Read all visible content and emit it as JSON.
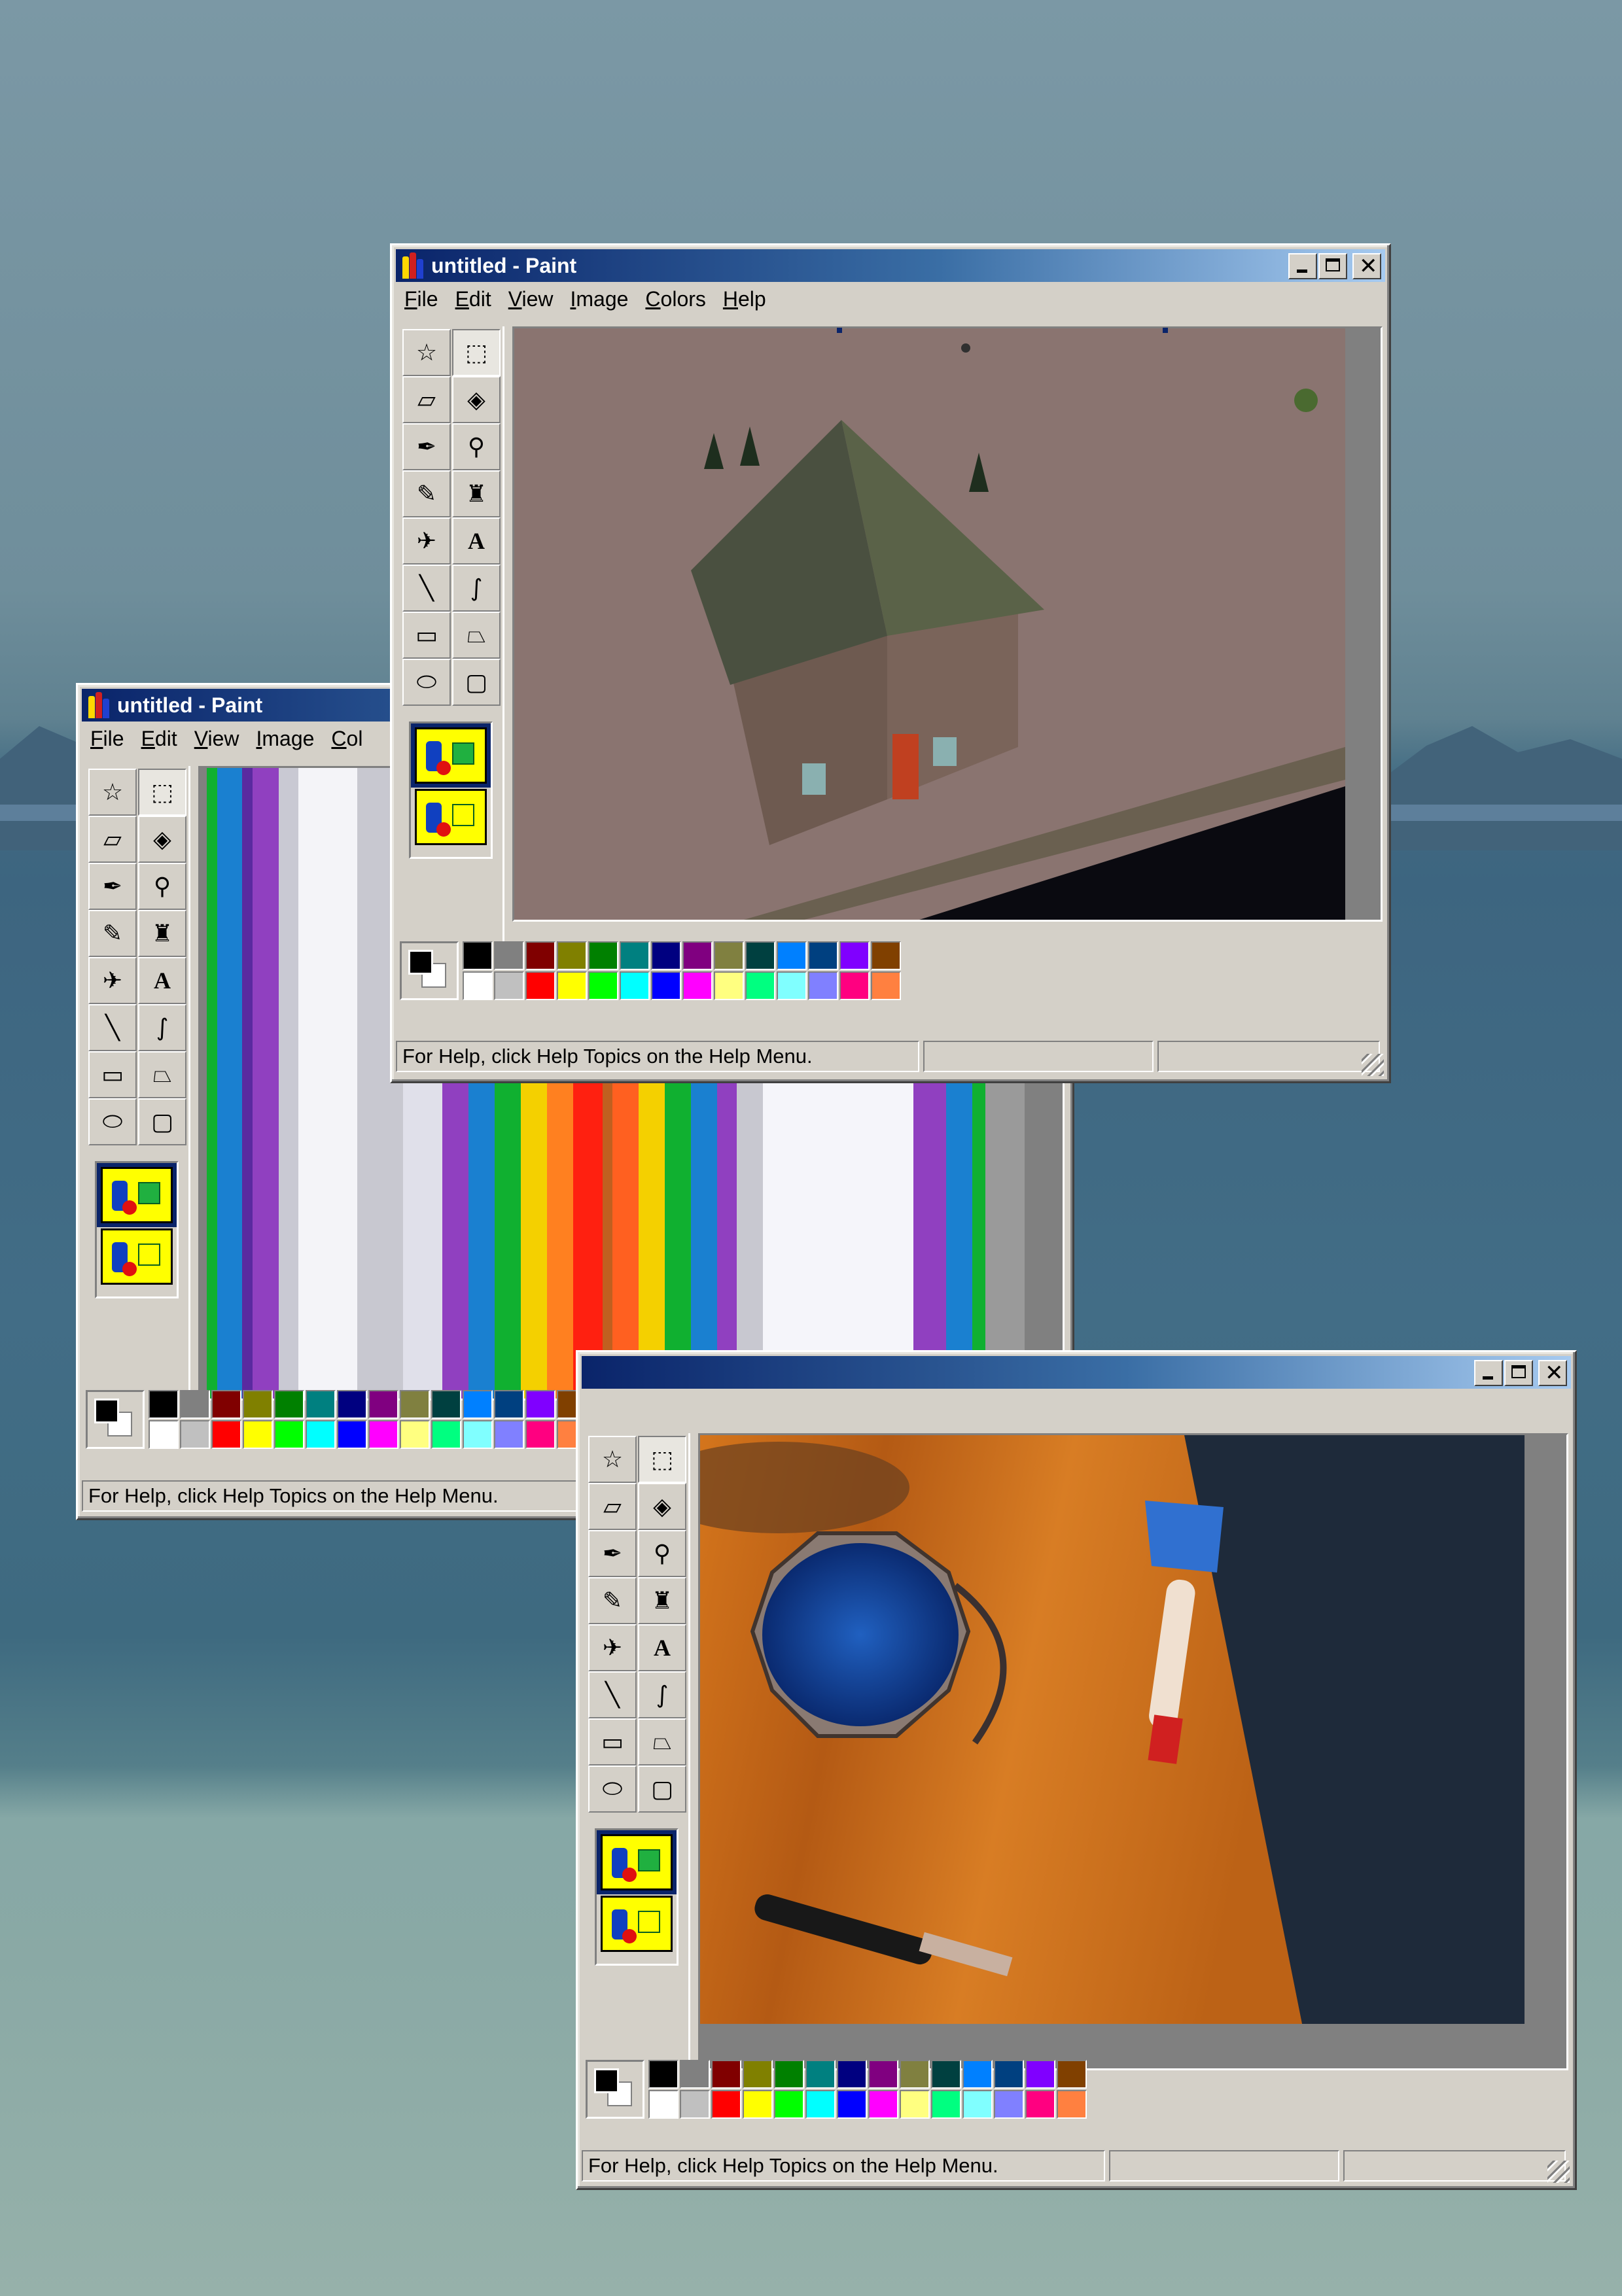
{
  "windows": [
    {
      "id": "house",
      "title": "untitled - Paint",
      "menus": [
        "File",
        "Edit",
        "View",
        "Image",
        "Colors",
        "Help"
      ],
      "status": "For Help, click Help Topics on the Help Menu.",
      "canvas": "3d-house-snow"
    },
    {
      "id": "stripes",
      "title": "untitled - Paint",
      "menus": [
        "File",
        "Edit",
        "View",
        "Image",
        "Col"
      ],
      "status": "For Help, click Help Topics on the Help Menu.",
      "canvas": "rainbow-stripes"
    },
    {
      "id": "bucket",
      "title": "",
      "menus": [],
      "status": "For Help, click Help Topics on the Help Menu.",
      "canvas": "paint-bucket-brush-hammer"
    }
  ],
  "palette_top": [
    "#000000",
    "#808080",
    "#800000",
    "#808000",
    "#008000",
    "#008080",
    "#000080",
    "#800080",
    "#808040",
    "#004040",
    "#0080ff",
    "#004080",
    "#8000ff",
    "#804000"
  ],
  "palette_bottom": [
    "#ffffff",
    "#c0c0c0",
    "#ff0000",
    "#ffff00",
    "#00ff00",
    "#00ffff",
    "#0000ff",
    "#ff00ff",
    "#ffff80",
    "#00ff80",
    "#80ffff",
    "#8080ff",
    "#ff0080",
    "#ff8040"
  ],
  "tools": [
    {
      "name": "free-select-icon",
      "glyph": "☆"
    },
    {
      "name": "rect-select-icon",
      "glyph": "⬚"
    },
    {
      "name": "eraser-icon",
      "glyph": "▱"
    },
    {
      "name": "fill-bucket-icon",
      "glyph": "◈"
    },
    {
      "name": "color-picker-icon",
      "glyph": "✒"
    },
    {
      "name": "magnifier-icon",
      "glyph": "⚲"
    },
    {
      "name": "pencil-icon",
      "glyph": "✎"
    },
    {
      "name": "brush-icon",
      "glyph": "♜"
    },
    {
      "name": "airbrush-icon",
      "glyph": "✈"
    },
    {
      "name": "text-icon",
      "glyph": "A"
    },
    {
      "name": "line-icon",
      "glyph": "╲"
    },
    {
      "name": "curve-icon",
      "glyph": "∫"
    },
    {
      "name": "rectangle-icon",
      "glyph": "▭"
    },
    {
      "name": "polygon-icon",
      "glyph": "⏢"
    },
    {
      "name": "ellipse-icon",
      "glyph": "⬭"
    },
    {
      "name": "rounded-rect-icon",
      "glyph": "▢"
    }
  ]
}
